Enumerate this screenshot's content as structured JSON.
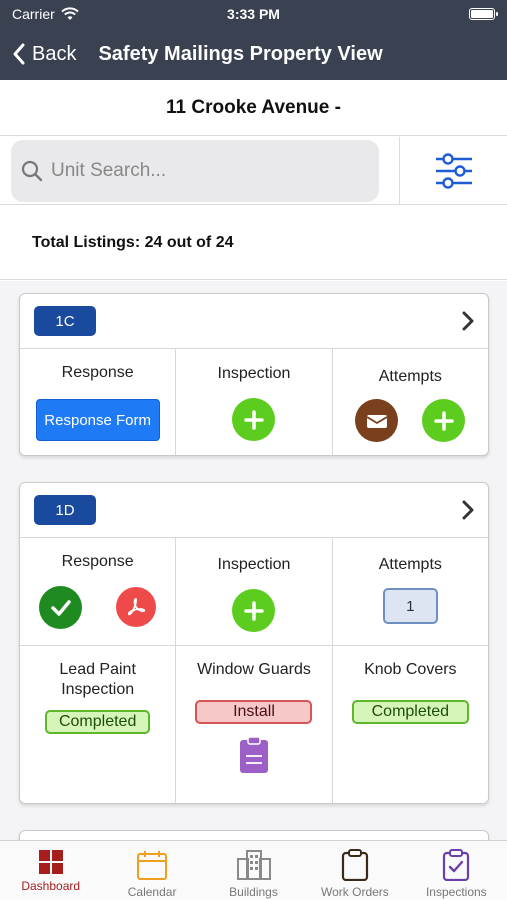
{
  "status": {
    "carrier": "Carrier",
    "time": "3:33 PM"
  },
  "nav": {
    "back_label": "Back",
    "title": "Safety Mailings Property View"
  },
  "address": "11 Crooke Avenue -",
  "search": {
    "placeholder": "Unit Search..."
  },
  "total": "Total Listings: 24 out of 24",
  "cards": [
    {
      "unit": "1C",
      "response_label": "Response",
      "response_button": "Response Form",
      "inspection_label": "Inspection",
      "attempts_label": "Attempts"
    },
    {
      "unit": "1D",
      "response_label": "Response",
      "inspection_label": "Inspection",
      "attempts_label": "Attempts",
      "attempts_count": "1",
      "lead_paint_label": "Lead Paint Inspection",
      "lead_paint_status": "Completed",
      "window_guards_label": "Window Guards",
      "window_guards_status": "Install",
      "knob_covers_label": "Knob Covers",
      "knob_covers_status": "Completed"
    }
  ],
  "tabs": [
    {
      "label": "Dashboard",
      "icon": "dashboard-icon",
      "color": "#a51d1d",
      "active": true
    },
    {
      "label": "Calendar",
      "icon": "calendar-icon",
      "color": "#f0a020"
    },
    {
      "label": "Buildings",
      "icon": "buildings-icon",
      "color": "#8a8a8a"
    },
    {
      "label": "Work Orders",
      "icon": "clipboard-icon",
      "color": "#4a3a2a"
    },
    {
      "label": "Inspections",
      "icon": "clipboard-check-icon",
      "color": "#6a3fa8"
    }
  ],
  "colors": {
    "nav_bg": "#3a4150",
    "unit_badge": "#1a4a9e",
    "green": "#5ccd1e",
    "completed_bg": "#d6f5b8",
    "install_bg": "#f7c8c8"
  }
}
